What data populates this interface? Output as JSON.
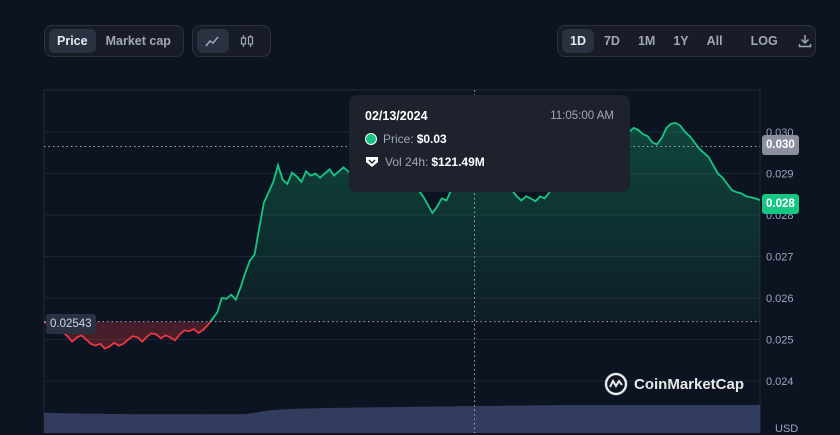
{
  "toolbar": {
    "metric_tabs": [
      "Price",
      "Market cap"
    ],
    "active_metric": "Price",
    "range_tabs": [
      "1D",
      "7D",
      "1M",
      "1Y",
      "All"
    ],
    "active_range": "1D",
    "log_label": "LOG"
  },
  "tooltip": {
    "date": "02/13/2024",
    "time": "11:05:00 AM",
    "price_label": "Price:",
    "price_value": "$0.03",
    "vol_label": "Vol 24h:",
    "vol_value": "$121.49M"
  },
  "axis_tags": {
    "open_price": "0.02543",
    "hover_price": "0.030",
    "current_price": "0.028",
    "currency": "USD"
  },
  "watermark": "CoinMarketCap",
  "colors": {
    "up": "#16c784",
    "down": "#ea3943",
    "background": "#0d1421",
    "volume": "#323c5d"
  },
  "chart_data": {
    "type": "line",
    "y_ticks": [
      "0.024",
      "0.025",
      "0.026",
      "0.027",
      "0.028",
      "0.029",
      "0.030"
    ],
    "ylim": [
      0.0235,
      0.0313
    ],
    "baseline": 0.02543,
    "hover_x": 0.6,
    "series": [
      {
        "values": [
          0.02543,
          0.02535,
          0.02525,
          0.02515,
          0.02518,
          0.02508,
          0.02495,
          0.02505,
          0.0251,
          0.025,
          0.0249,
          0.02485,
          0.0249,
          0.02478,
          0.02483,
          0.02492,
          0.02485,
          0.0249,
          0.025,
          0.02508,
          0.02505,
          0.02495,
          0.02507,
          0.02515,
          0.02512,
          0.02503,
          0.0251,
          0.02505,
          0.02498,
          0.02512,
          0.02522,
          0.0252,
          0.02525,
          0.02516,
          0.02523,
          0.02535,
          0.0255,
          0.02565,
          0.026,
          0.02598,
          0.02608,
          0.02596,
          0.02625,
          0.0266,
          0.0269,
          0.02705,
          0.0277,
          0.0283,
          0.02855,
          0.0288,
          0.0292,
          0.02885,
          0.02875,
          0.02902,
          0.02893,
          0.0288,
          0.02905,
          0.02895,
          0.029,
          0.0289,
          0.029,
          0.0291,
          0.02895,
          0.02905,
          0.02915,
          0.02905,
          0.029,
          0.0291,
          0.029,
          0.02905,
          0.02915,
          0.029,
          0.02907,
          0.0292,
          0.0293,
          0.02915,
          0.02898,
          0.02895,
          0.0288,
          0.0287,
          0.0286,
          0.02845,
          0.02825,
          0.02805,
          0.0282,
          0.0284,
          0.02835,
          0.0286,
          0.0289,
          0.0291,
          0.02935,
          0.0295,
          0.02965,
          0.0298,
          0.0297,
          0.0295,
          0.0293,
          0.0291,
          0.0289,
          0.02875,
          0.0286,
          0.02845,
          0.02835,
          0.02845,
          0.0284,
          0.02833,
          0.02845,
          0.0284,
          0.02855,
          0.02875,
          0.029,
          0.02925,
          0.0295,
          0.0297,
          0.0299,
          0.0298,
          0.02985,
          0.0297,
          0.0298,
          0.0299,
          0.0298,
          0.0297,
          0.02975,
          0.0299,
          0.02995,
          0.03,
          0.0301,
          0.03005,
          0.02995,
          0.0299,
          0.02975,
          0.0297,
          0.02985,
          0.0301,
          0.0302,
          0.03022,
          0.03015,
          0.03,
          0.0299,
          0.02975,
          0.0296,
          0.0295,
          0.0294,
          0.0292,
          0.029,
          0.0289,
          0.02875,
          0.0286,
          0.02855,
          0.02852,
          0.02845,
          0.02843,
          0.0284,
          0.02836
        ]
      }
    ],
    "volume": [
      0.72,
      0.72,
      0.71,
      0.71,
      0.71,
      0.7,
      0.7,
      0.7,
      0.69,
      0.69,
      0.69,
      0.69,
      0.69,
      0.68,
      0.68,
      0.68,
      0.68,
      0.68,
      0.67,
      0.67,
      0.67,
      0.67,
      0.67,
      0.67,
      0.67,
      0.67,
      0.67,
      0.67,
      0.67,
      0.67,
      0.67,
      0.67,
      0.67,
      0.67,
      0.67,
      0.67,
      0.67,
      0.67,
      0.67,
      0.67,
      0.67,
      0.67,
      0.67,
      0.67,
      0.68,
      0.7,
      0.72,
      0.75,
      0.78,
      0.8,
      0.82,
      0.83,
      0.84,
      0.85,
      0.86,
      0.86,
      0.87,
      0.87,
      0.88,
      0.88,
      0.88,
      0.89,
      0.89,
      0.89,
      0.9,
      0.9,
      0.9,
      0.9,
      0.91,
      0.91,
      0.91,
      0.91,
      0.92,
      0.92,
      0.92,
      0.92,
      0.92,
      0.93,
      0.93,
      0.93,
      0.93,
      0.94,
      0.94,
      0.94,
      0.94,
      0.94,
      0.95,
      0.95,
      0.95,
      0.95,
      0.95,
      0.96,
      0.96,
      0.96,
      0.96,
      0.96,
      0.97,
      0.97,
      0.97,
      0.97,
      0.97,
      0.98,
      0.98,
      0.98,
      0.98,
      0.98,
      0.98,
      0.99,
      0.99,
      0.99,
      0.99,
      0.99,
      0.99,
      1,
      1,
      1,
      1,
      1,
      1,
      1,
      1,
      1,
      1,
      1,
      1,
      1,
      1,
      1,
      1,
      1,
      1,
      1,
      1,
      1,
      1,
      1,
      1,
      1,
      1,
      1,
      1,
      1,
      1,
      1,
      1,
      1,
      1,
      1,
      1,
      1,
      1,
      1,
      1,
      1,
      1,
      1,
      1,
      1
    ]
  }
}
